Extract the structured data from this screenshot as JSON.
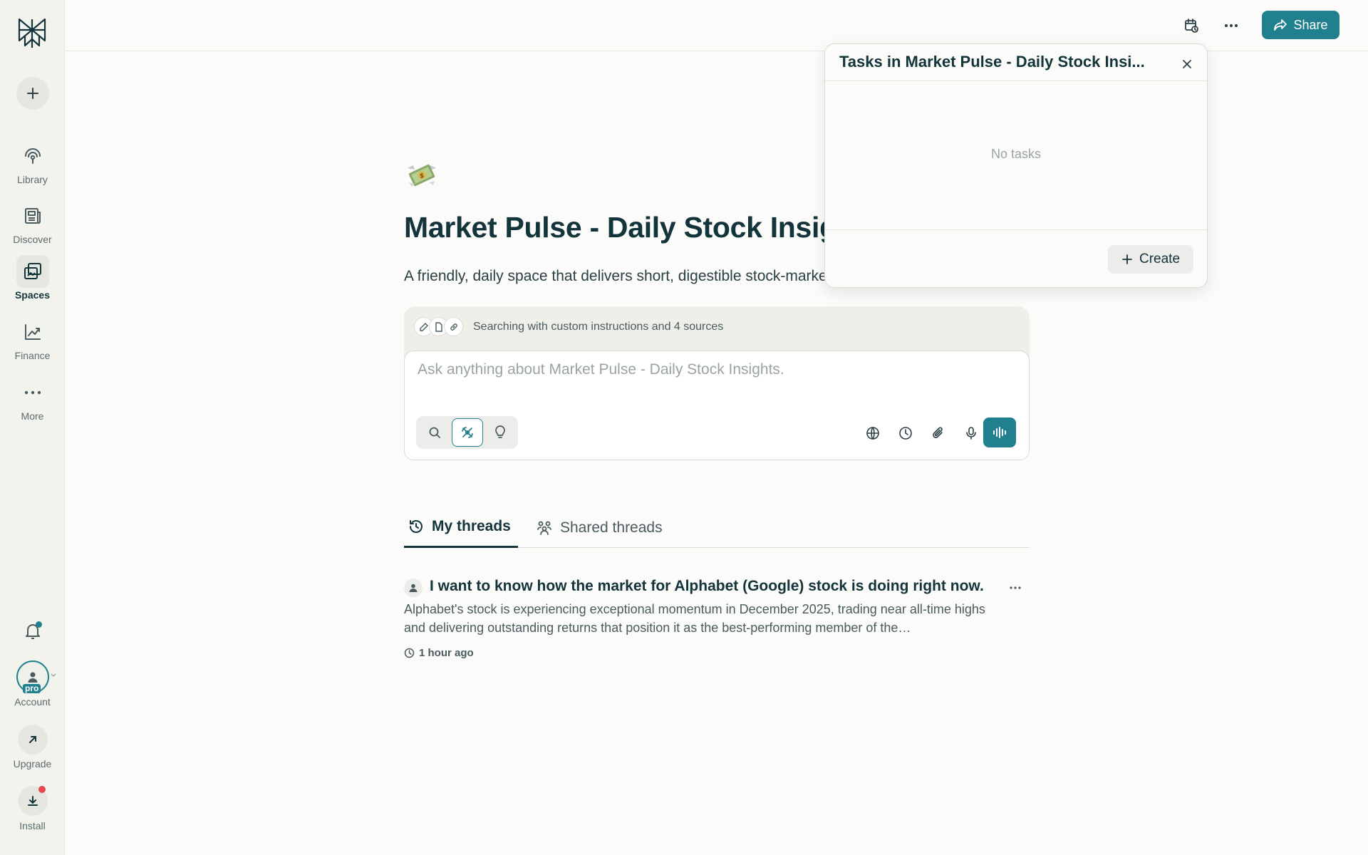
{
  "sidebar": {
    "logo": "perplexity-logo",
    "new_thread": "plus-icon",
    "items": [
      {
        "label": "Library",
        "icon": "library-icon"
      },
      {
        "label": "Discover",
        "icon": "discover-icon"
      },
      {
        "label": "Spaces",
        "icon": "spaces-icon",
        "active": true
      },
      {
        "label": "Finance",
        "icon": "finance-icon"
      },
      {
        "label": "More",
        "icon": "more-icon"
      }
    ],
    "account": {
      "label": "Account",
      "badge": "pro"
    },
    "upgrade": {
      "label": "Upgrade"
    },
    "install": {
      "label": "Install"
    }
  },
  "topbar": {
    "share_label": "Share"
  },
  "space": {
    "emoji": "money-with-wings",
    "title": "Market Pulse - Daily Stock Insights",
    "description": "A friendly, daily space that delivers short, digestible stock-market insights."
  },
  "search": {
    "meta_text": "Searching with custom instructions and 4 sources",
    "placeholder": "Ask anything about Market Pulse - Daily Stock Insights."
  },
  "tabs": [
    {
      "label": "My threads",
      "active": true
    },
    {
      "label": "Shared threads",
      "active": false
    }
  ],
  "threads": [
    {
      "title": "I want to know how the market for Alphabet (Google) stock is doing right now.",
      "snippet": "Alphabet's stock is experiencing exceptional momentum in December 2025, trading near all-time highs and delivering outstanding returns that position it as the best-performing member of the…",
      "time": "1 hour ago"
    }
  ],
  "tasks_popover": {
    "title": "Tasks in Market Pulse - Daily Stock Insi...",
    "empty_text": "No tasks",
    "create_label": "Create"
  },
  "colors": {
    "accent": "#20808d",
    "text": "#13343b",
    "sidebar_bg": "#f3f3ee",
    "page_bg": "#fbfbf9"
  }
}
